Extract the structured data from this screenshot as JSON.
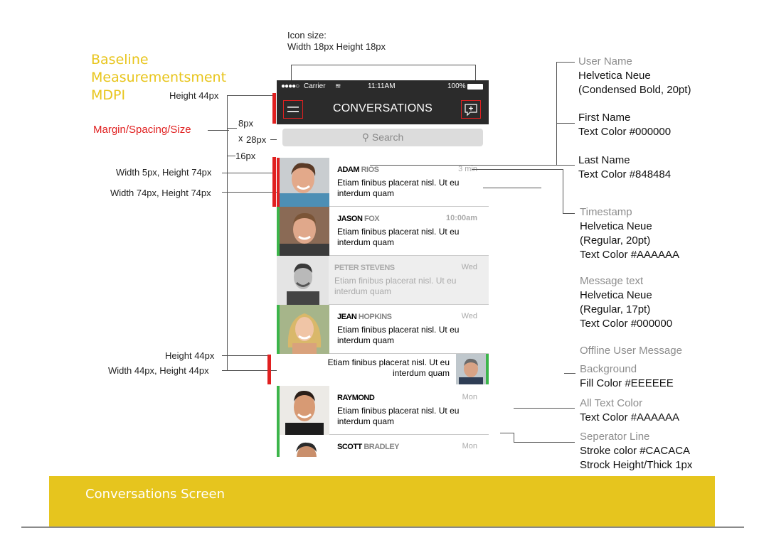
{
  "left_panel": {
    "title_lines": [
      "Baseline",
      "Measurementsment",
      "MDPI"
    ],
    "margin_title": "Margin/Spacing/Size",
    "annotations": {
      "icon_size_line1": "Icon size:",
      "icon_size_line2": "Width 18px Height 18px",
      "header_height": "Height 44px",
      "spacing_8": "8px",
      "spacing_x": "x",
      "spacing_28": "28px",
      "spacing_16": "16px",
      "bar_size": "Width 5px, Height 74px",
      "avatar_size": "Width 74px, Height 74px",
      "sent_height": "Height 44px",
      "sent_avatar_size": "Width 44px, Height 44px"
    }
  },
  "phone": {
    "status": {
      "carrier": "Carrier",
      "time": "11:11AM",
      "battery": "100%"
    },
    "nav": {
      "title": "CONVERSATIONS",
      "menu_icon": "hamburger-icon",
      "compose_icon": "compose-icon"
    },
    "search": {
      "placeholder": "Search",
      "icon": "search-icon"
    },
    "conversations": [
      {
        "first": "ADAM",
        "last": "RIOS",
        "time": "3 min",
        "message": "Etiam finibus placerat nisl. Ut eu interdum quam",
        "status": "unread"
      },
      {
        "first": "JASON",
        "last": "FOX",
        "time": "10:00am",
        "message": "Etiam finibus placerat nisl. Ut eu interdum quam",
        "status": "online"
      },
      {
        "first": "PETER",
        "last": "STEVENS",
        "time": "Wed",
        "message": "Etiam finibus placerat nisl. Ut eu interdum quam",
        "status": "offline"
      },
      {
        "first": "JEAN",
        "last": "HOPKINS",
        "time": "Wed",
        "message": "Etiam finibus placerat nisl. Ut eu interdum quam",
        "status": "online"
      },
      {
        "first": "RAYMOND",
        "last": "",
        "time": "Mon",
        "message": "Etiam finibus placerat nisl. Ut eu interdum quam",
        "status": "online"
      },
      {
        "first": "SCOTT",
        "last": "BRADLEY",
        "time": "Mon",
        "message": "",
        "status": "online"
      }
    ],
    "sent_message": "Etiam finibus placerat nisl. Ut eu interdum quam"
  },
  "right_panel": [
    {
      "heading": "User Name",
      "lines": [
        "Helvetica Neue",
        "(Condensed Bold, 20pt)"
      ]
    },
    {
      "heading": "First Name",
      "lines": [
        "Text Color #000000"
      ]
    },
    {
      "heading": "Last Name",
      "lines": [
        "Text Color #848484"
      ]
    },
    {
      "heading": "Timestamp",
      "lines": [
        "Helvetica Neue",
        "(Regular, 20pt)",
        "Text Color #AAAAAA"
      ]
    },
    {
      "heading": "Message text",
      "lines": [
        "Helvetica Neue",
        "(Regular, 17pt)",
        "Text Color #000000"
      ]
    },
    {
      "heading": "Offline User Message",
      "lines": []
    },
    {
      "heading": "Background",
      "lines": [
        "Fill Color #EEEEEE"
      ]
    },
    {
      "heading": "All Text Color",
      "lines": [
        "Text Color #AAAAAA"
      ]
    },
    {
      "heading": "Seperator Line",
      "lines": [
        "Stroke color #CACACA",
        "Strock Height/Thick 1px"
      ]
    }
  ],
  "footer": {
    "title": "Conversations Screen"
  },
  "colors": {
    "accent_yellow": "#e6c51e",
    "red": "#e02020",
    "online_green": "#3cb54a",
    "nav_dark": "#2b2b2b"
  }
}
